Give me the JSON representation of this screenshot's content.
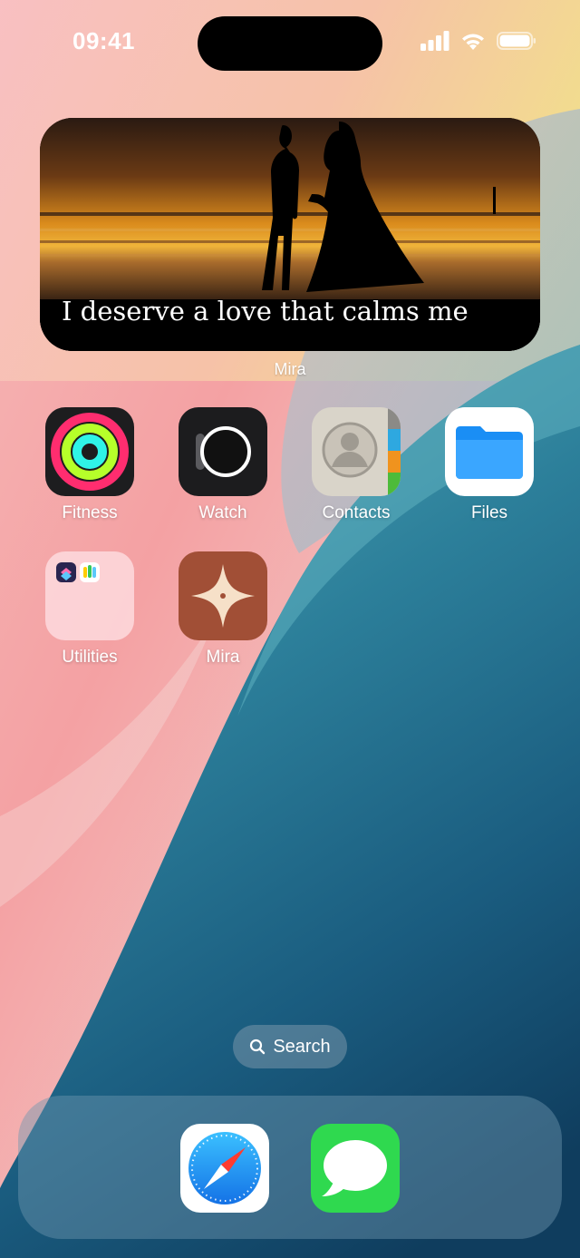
{
  "status_bar": {
    "time": "09:41"
  },
  "widget": {
    "quote": "I deserve a love that calms me",
    "label": "Mira"
  },
  "apps": [
    {
      "label": "Fitness",
      "icon": "fitness-rings-icon"
    },
    {
      "label": "Watch",
      "icon": "watch-icon"
    },
    {
      "label": "Contacts",
      "icon": "contacts-icon"
    },
    {
      "label": "Files",
      "icon": "files-folder-icon"
    },
    {
      "label": "Utilities",
      "icon": "utilities-folder-icon"
    },
    {
      "label": "Mira",
      "icon": "mira-compass-icon"
    }
  ],
  "search": {
    "label": "Search",
    "icon": "magnifier-icon"
  },
  "dock": [
    {
      "icon": "safari-compass-icon"
    },
    {
      "icon": "messages-bubble-icon"
    }
  ],
  "colors": {
    "fitness_move": "#ff2d6f",
    "fitness_exercise": "#b6ff2a",
    "fitness_stand": "#2ff4e8",
    "files_blue": "#1a8ef5",
    "mira_brown": "#a14f36",
    "messages_green": "#2fd94f",
    "safari_blue": "#2196f3"
  }
}
